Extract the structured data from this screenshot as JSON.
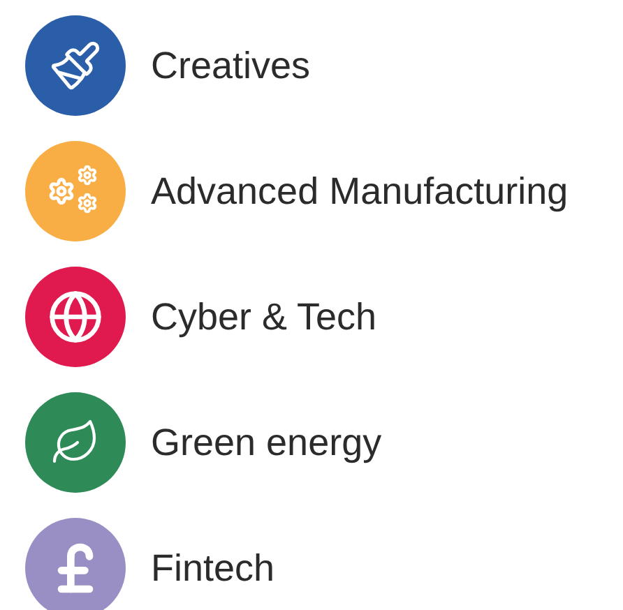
{
  "sectors": [
    {
      "label": "Creatives",
      "kind": "brush",
      "color": "#2a5ea8"
    },
    {
      "label": "Advanced Manufacturing",
      "kind": "gears",
      "color": "#f9ad45"
    },
    {
      "label": "Cyber & Tech",
      "kind": "globe",
      "color": "#e01a4f"
    },
    {
      "label": "Green energy",
      "kind": "leaf",
      "color": "#2e8b57"
    },
    {
      "label": "Fintech",
      "kind": "pound",
      "color": "#9a8fc4"
    }
  ]
}
